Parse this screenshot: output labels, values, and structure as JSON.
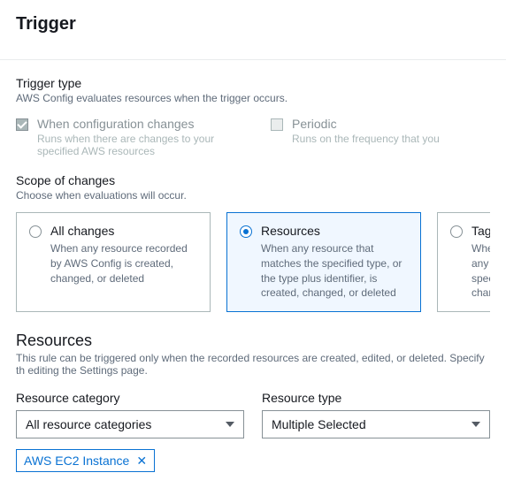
{
  "header": {
    "title": "Trigger"
  },
  "triggerType": {
    "label": "Trigger type",
    "desc": "AWS Config evaluates resources when the trigger occurs.",
    "options": [
      {
        "title": "When configuration changes",
        "desc": "Runs when there are changes to your specified AWS resources",
        "checked": true
      },
      {
        "title": "Periodic",
        "desc": "Runs on the frequency that you",
        "checked": false
      }
    ]
  },
  "scope": {
    "label": "Scope of changes",
    "desc": "Choose when evaluations will occur.",
    "options": [
      {
        "title": "All changes",
        "desc": "When any resource recorded by AWS Config is created, changed, or deleted",
        "selected": false
      },
      {
        "title": "Resources",
        "desc": "When any resource that matches the specified type, or the type plus identifier, is created, changed, or deleted",
        "selected": true
      },
      {
        "title": "Tags",
        "desc": "When any specifi chang",
        "selected": false
      }
    ]
  },
  "resources": {
    "title": "Resources",
    "desc": "This rule can be triggered only when the recorded resources are created, edited, or deleted. Specify th editing the Settings page.",
    "category": {
      "label": "Resource category",
      "value": "All resource categories"
    },
    "type": {
      "label": "Resource type",
      "value": "Multiple Selected"
    },
    "tags": [
      {
        "label": "AWS EC2 Instance"
      }
    ]
  }
}
